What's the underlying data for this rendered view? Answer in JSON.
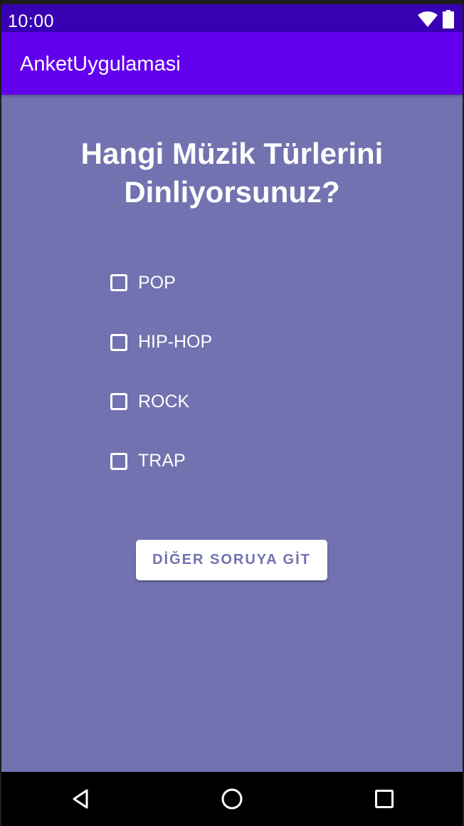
{
  "status_bar": {
    "time": "10:00",
    "icons": [
      "wifi-icon",
      "battery-icon"
    ]
  },
  "app_bar": {
    "title": "AnketUygulamasi"
  },
  "question": {
    "text": "Hangi Müzik Türlerini Dinliyorsunuz?"
  },
  "options": [
    {
      "label": "POP",
      "checked": false
    },
    {
      "label": "HIP-HOP",
      "checked": false
    },
    {
      "label": "ROCK",
      "checked": false
    },
    {
      "label": "TRAP",
      "checked": false
    }
  ],
  "next_button": {
    "label": "DİĞER SORUYA GİT"
  },
  "nav_bar": {
    "icons": [
      "back-icon",
      "home-icon",
      "recents-icon"
    ]
  },
  "colors": {
    "status_bar": "#3700b3",
    "app_bar": "#6200ee",
    "background": "#7272b0",
    "button_bg": "#ffffff",
    "button_text": "#7272b0"
  }
}
